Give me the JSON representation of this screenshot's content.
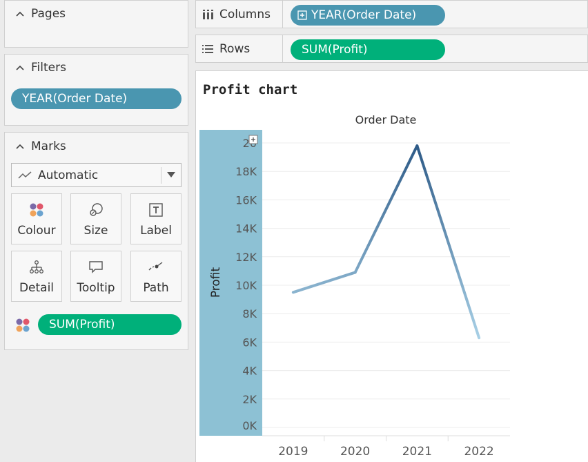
{
  "pages_card": {
    "title": "Pages"
  },
  "filters_card": {
    "title": "Filters",
    "pill": "YEAR(Order Date)"
  },
  "marks_card": {
    "title": "Marks",
    "mark_type": "Automatic",
    "buttons": [
      {
        "label": "Colour",
        "icon": "colour-icon"
      },
      {
        "label": "Size",
        "icon": "size-icon"
      },
      {
        "label": "Label",
        "icon": "label-icon"
      },
      {
        "label": "Detail",
        "icon": "detail-icon"
      },
      {
        "label": "Tooltip",
        "icon": "tooltip-icon"
      },
      {
        "label": "Path",
        "icon": "path-icon"
      }
    ],
    "colour_field": "SUM(Profit)"
  },
  "columns_shelf": {
    "label": "Columns",
    "pill": "YEAR(Order Date)"
  },
  "rows_shelf": {
    "label": "Rows",
    "pill": "SUM(Profit)"
  },
  "colors": {
    "blue_pill": "#4a96b0",
    "green_pill": "#00b07a",
    "axis_band": "#8dc1d4",
    "line_start": "#a8d0e6",
    "line_peak": "#2d5a87"
  },
  "chart_data": {
    "type": "line",
    "title": "Profit chart",
    "column_header": "Order Date",
    "ylabel": "Profit",
    "categories": [
      "2019",
      "2020",
      "2021",
      "2022"
    ],
    "series": [
      {
        "values": [
          9500,
          10900,
          19800,
          6300
        ]
      }
    ],
    "y_ticks": [
      "0K",
      "2K",
      "4K",
      "6K",
      "8K",
      "10K",
      "12K",
      "14K",
      "16K",
      "18K",
      "20"
    ],
    "ylim": [
      0,
      20000
    ],
    "grid": true,
    "color_encoding": "SUM(Profit)"
  }
}
